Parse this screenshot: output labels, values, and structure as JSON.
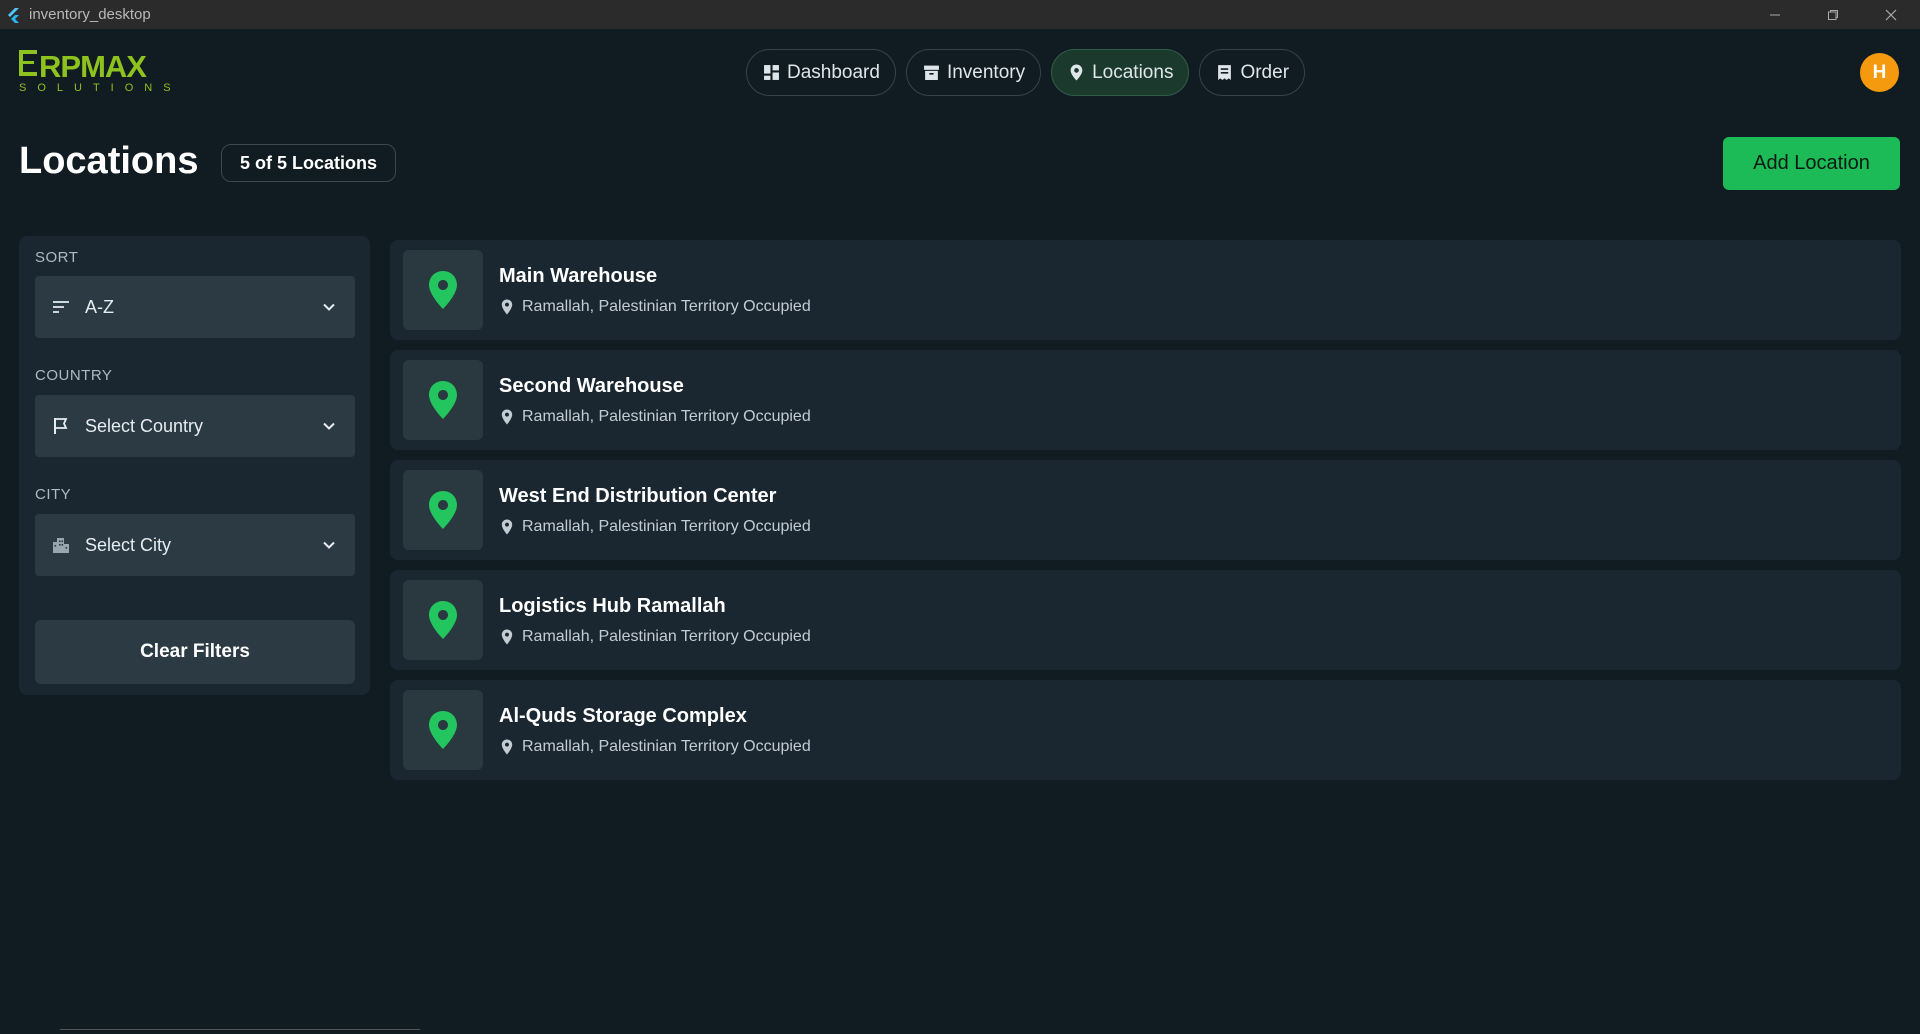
{
  "window": {
    "title": "inventory_desktop"
  },
  "logo": {
    "text": "ERPMAX",
    "subtitle": "SOLUTIONS"
  },
  "nav": {
    "tabs": [
      {
        "label": "Dashboard",
        "icon": "dashboard-icon",
        "active": false
      },
      {
        "label": "Inventory",
        "icon": "archive-icon",
        "active": false
      },
      {
        "label": "Locations",
        "icon": "location-pin-icon",
        "active": true
      },
      {
        "label": "Order",
        "icon": "receipt-icon",
        "active": false
      }
    ]
  },
  "user": {
    "initial": "H",
    "avatar_color": "#f59a0e"
  },
  "page": {
    "title": "Locations",
    "count_badge": "5 of 5 Locations",
    "add_button": "Add Location"
  },
  "filters": {
    "sort": {
      "label": "SORT",
      "value": "A-Z"
    },
    "country": {
      "label": "COUNTRY",
      "placeholder": "Select Country"
    },
    "city": {
      "label": "CITY",
      "placeholder": "Select City"
    },
    "clear_button": "Clear Filters"
  },
  "locations": [
    {
      "name": "Main Warehouse",
      "address": "Ramallah, Palestinian Territory Occupied"
    },
    {
      "name": "Second Warehouse",
      "address": "Ramallah, Palestinian Territory Occupied"
    },
    {
      "name": "West End Distribution Center",
      "address": "Ramallah, Palestinian Territory Occupied"
    },
    {
      "name": "Logistics Hub Ramallah",
      "address": "Ramallah, Palestinian Territory Occupied"
    },
    {
      "name": "Al-Quds Storage Complex",
      "address": "Ramallah, Palestinian Territory Occupied"
    }
  ],
  "colors": {
    "accent": "#1dbb58",
    "pin": "#22c55e",
    "background": "#111b22",
    "card": "#1b2730"
  }
}
